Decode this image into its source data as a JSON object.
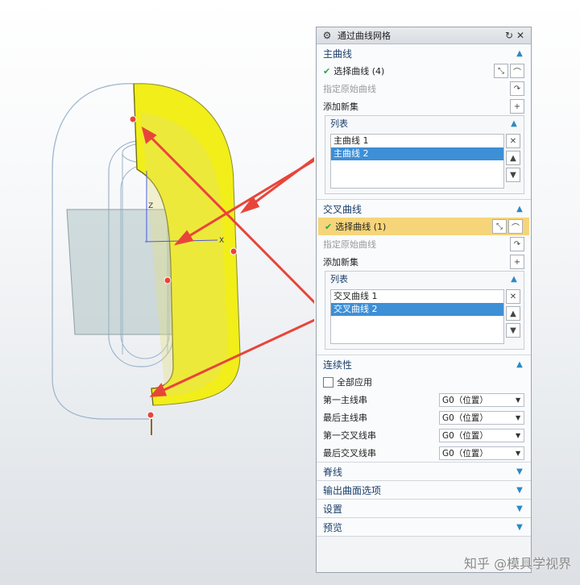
{
  "dialog": {
    "title": "通过曲线网格",
    "icons": {
      "settings": "gear-icon",
      "reset": "reset-icon",
      "close": "close-icon"
    }
  },
  "main_curves": {
    "header": "主曲线",
    "select_label": "选择曲线 (4)",
    "origin_label": "指定原始曲线",
    "add_set_label": "添加新集",
    "list_header": "列表",
    "items": [
      "主曲线 1",
      "主曲线 2"
    ],
    "selected_index": 1
  },
  "cross_curves": {
    "header": "交叉曲线",
    "select_label": "选择曲线 (1)",
    "origin_label": "指定原始曲线",
    "add_set_label": "添加新集",
    "list_header": "列表",
    "items": [
      "交叉曲线 1",
      "交叉曲线 2"
    ],
    "selected_index": 1
  },
  "continuity": {
    "header": "连续性",
    "apply_all": "全部应用",
    "rows": [
      {
        "label": "第一主线串",
        "value": "G0（位置）"
      },
      {
        "label": "最后主线串",
        "value": "G0（位置）"
      },
      {
        "label": "第一交叉线串",
        "value": "G0（位置）"
      },
      {
        "label": "最后交叉线串",
        "value": "G0（位置）"
      }
    ]
  },
  "collapsed_sections": [
    "脊线",
    "输出曲面选项",
    "设置",
    "预览"
  ],
  "watermark": "知乎 @模具学视界",
  "viewport": {
    "axis_x": "X",
    "axis_z": "Z"
  },
  "colors": {
    "accent": "#2b8ac2",
    "highlight": "#f6d57a",
    "selection": "#3d8fd6",
    "surface": "#f1ee1a",
    "arrow": "#e8453a"
  }
}
